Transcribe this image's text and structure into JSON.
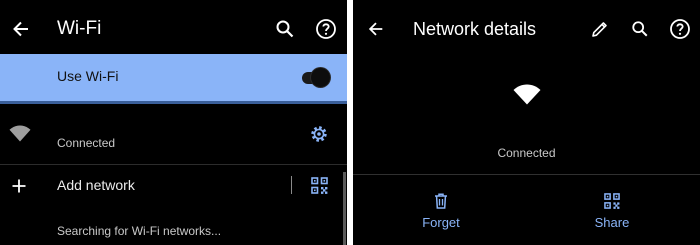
{
  "left": {
    "title": "Wi-Fi",
    "use_wifi_label": "Use Wi-Fi",
    "use_wifi_on": true,
    "network_status": "Connected",
    "add_network_label": "Add network",
    "searching_text": "Searching for Wi-Fi networks...",
    "accent_color": "#8ab4f8"
  },
  "right": {
    "title": "Network details",
    "status": "Connected",
    "forget_label": "Forget",
    "share_label": "Share",
    "accent_color": "#8ab4f8"
  },
  "icons": [
    "back-arrow-icon",
    "search-icon",
    "help-icon",
    "wifi-icon",
    "gear-icon",
    "plus-icon",
    "qr-code-icon",
    "pencil-icon",
    "trash-icon"
  ]
}
